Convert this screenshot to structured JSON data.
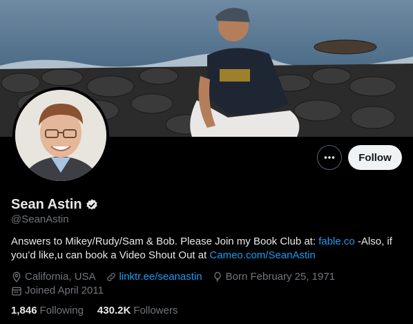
{
  "profile": {
    "display_name": "Sean Astin",
    "handle": "@SeanAstin",
    "bio_text_1": "Answers to Mikey/Rudy/Sam & Bob. Please Join my Book Club at: ",
    "bio_link_1": "fable.co",
    "bio_text_2": " -Also, if you’d like,u can book a Video Shout Out at ",
    "bio_link_2": "Cameo.com/SeanAstin",
    "location": "California, USA",
    "website": "linktr.ee/seanastin",
    "birthday": "Born February 25, 1971",
    "joined": "Joined April 2011"
  },
  "stats": {
    "following_count": "1,846",
    "following_label": "Following",
    "followers_count": "430.2K",
    "followers_label": "Followers"
  },
  "actions": {
    "follow_label": "Follow"
  },
  "icons": {
    "more": "more-horizontal-icon",
    "verified": "verified-badge-icon",
    "location": "location-pin-icon",
    "link": "link-icon",
    "birthday": "balloon-icon",
    "calendar": "calendar-icon"
  },
  "colors": {
    "background": "#000000",
    "text_primary": "#e7e9ea",
    "text_secondary": "#71767b",
    "link": "#1d9bf0",
    "follow_bg": "#eff3f4"
  }
}
